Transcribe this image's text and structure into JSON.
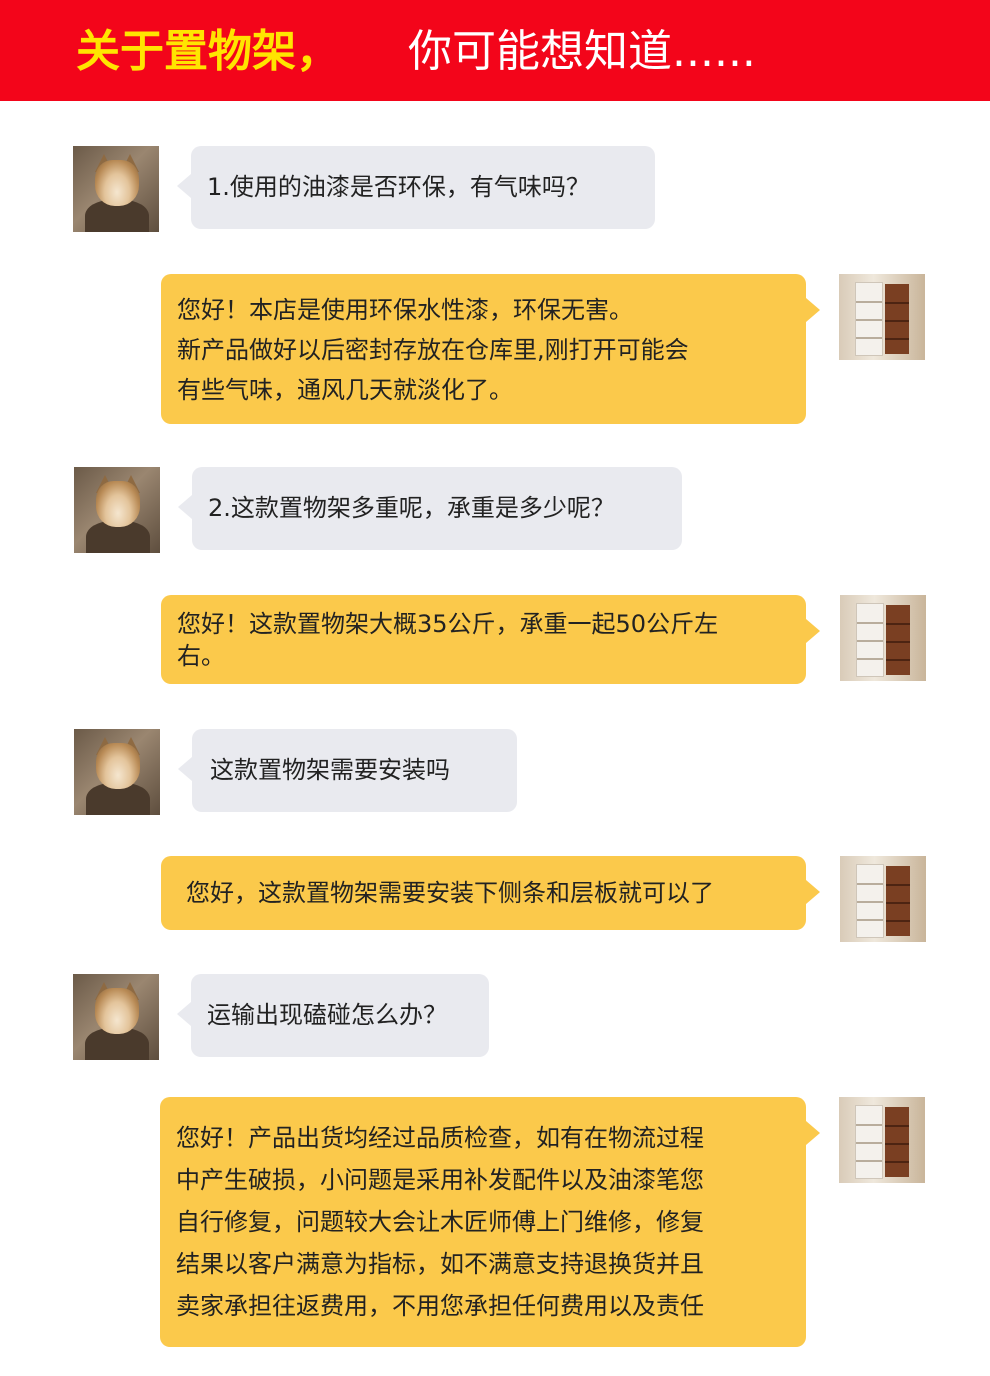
{
  "header": {
    "title_highlight": "关于置物架，",
    "title_rest": "你可能想知道......"
  },
  "faq": [
    {
      "question": "1.使用的油漆是否环保，有气味吗？",
      "answer_lines": [
        "您好！本店是使用环保水性漆，环保无害。",
        "新产品做好以后密封存放在仓库里,刚打开可能会",
        "有些气味，通风几天就淡化了。"
      ]
    },
    {
      "question": "2.这款置物架多重呢，承重是多少呢？",
      "answer_lines": [
        "您好！这款置物架大概35公斤，承重一起50公斤左",
        "右。"
      ]
    },
    {
      "question": "这款置物架需要安装吗",
      "answer_lines": [
        "您好，这款置物架需要安装下侧条和层板就可以了"
      ]
    },
    {
      "question": "运输出现磕碰怎么办？",
      "answer_lines": [
        "您好！产品出货均经过品质检查，如有在物流过程",
        "中产生破损，小问题是采用补发配件以及油漆笔您",
        "自行修复，问题较大会让木匠师傅上门维修，修复",
        "结果以客户满意为指标，如不满意支持退换货并且",
        "卖家承担往返费用，不用您承担任何费用以及责任"
      ]
    }
  ],
  "icons": {
    "customer_avatar": "shiba-dog-avatar",
    "seller_avatar": "shelf-product-avatar"
  },
  "colors": {
    "header_bg": "#f3051a",
    "header_highlight": "#ffe500",
    "question_bubble": "#e9eaef",
    "answer_bubble": "#fbc94b"
  }
}
